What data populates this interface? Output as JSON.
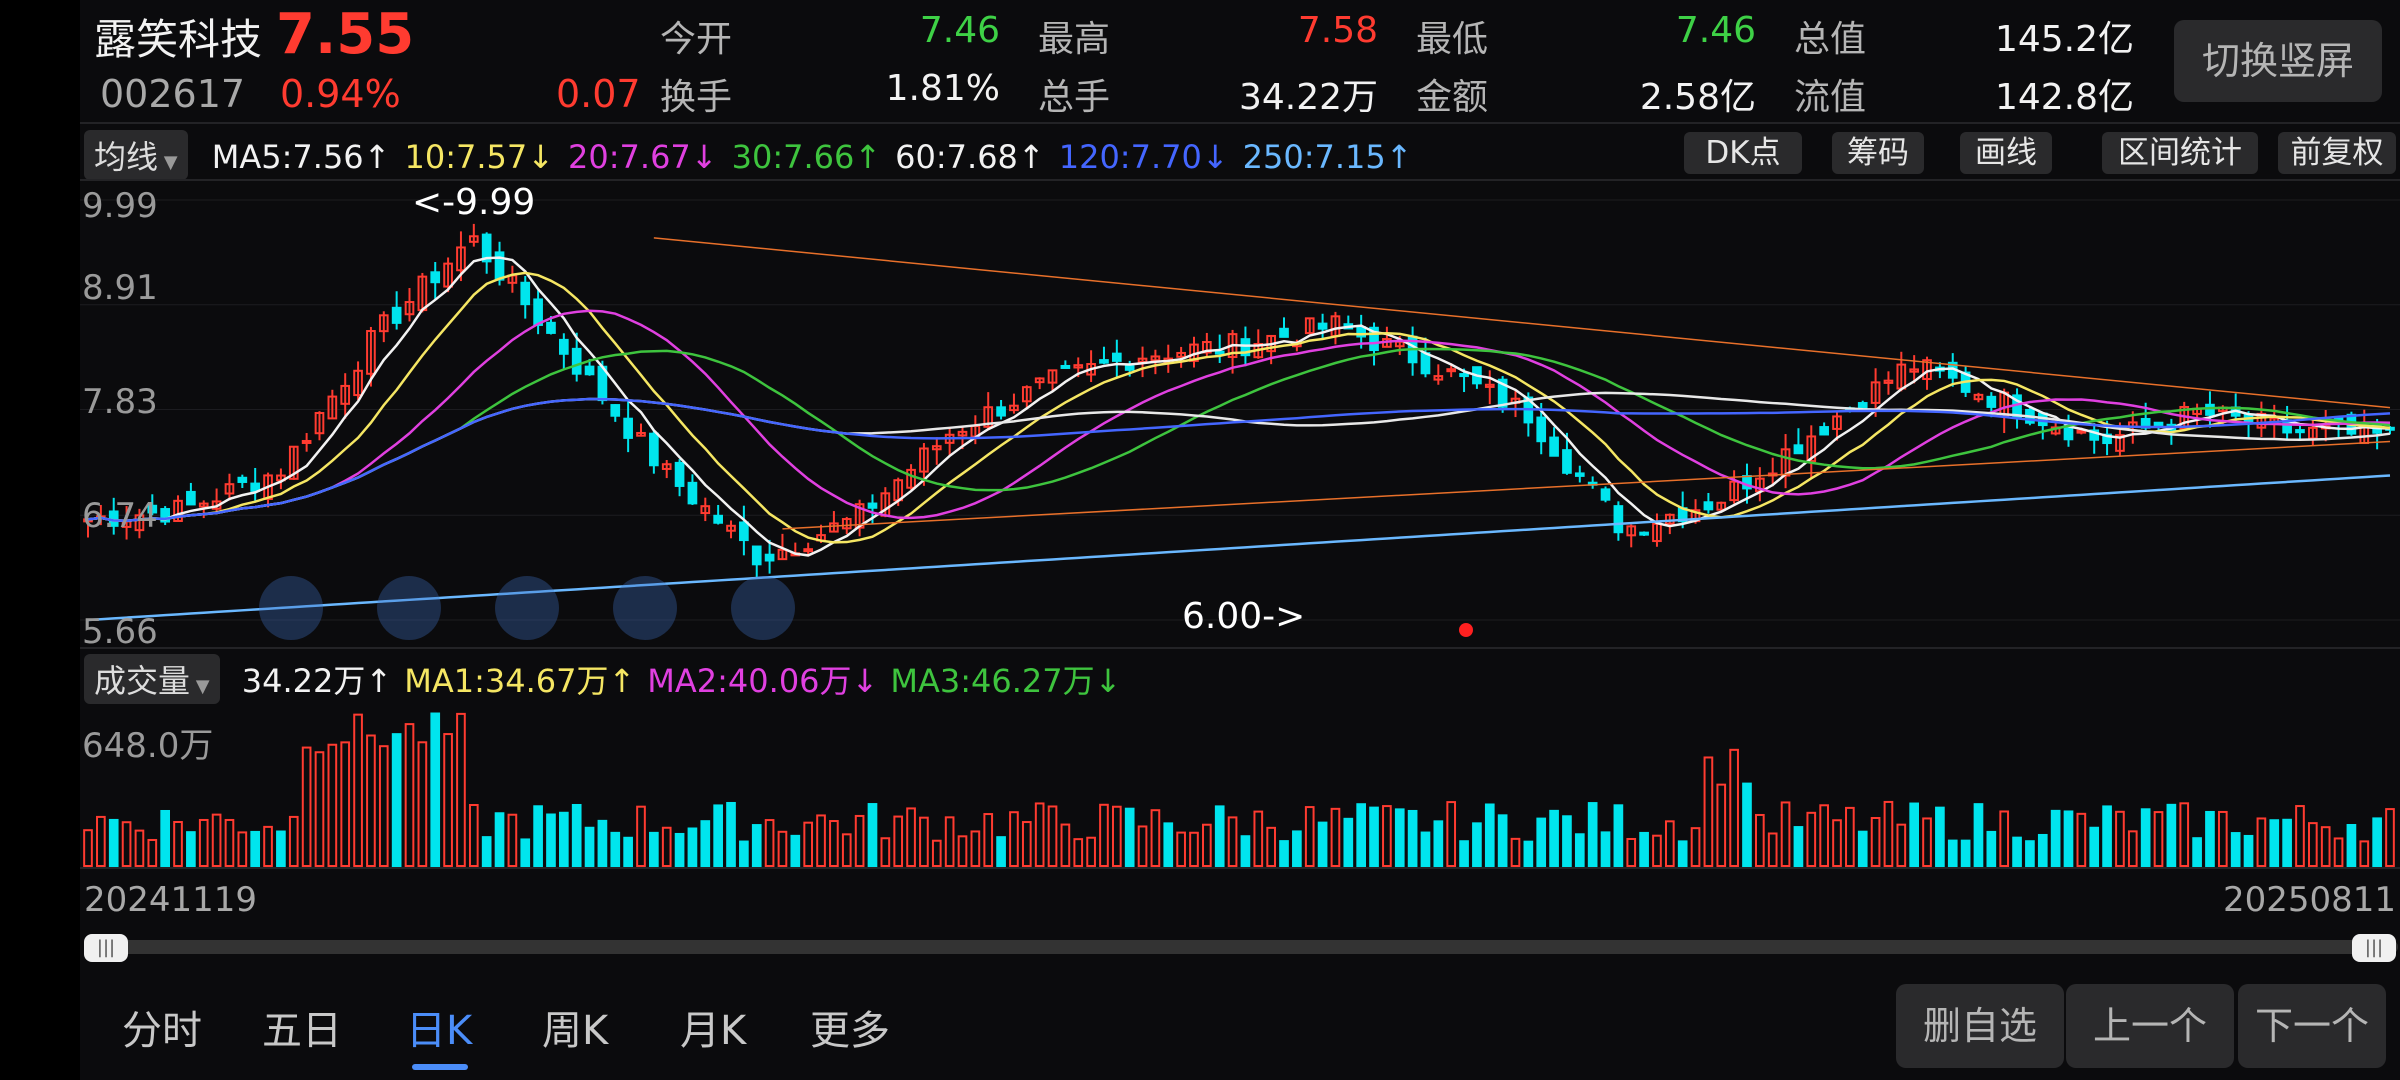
{
  "stock": {
    "name": "露笑科技",
    "price": "7.55",
    "code": "002617",
    "change_pct": "0.94%",
    "change": "0.07"
  },
  "stats": [
    {
      "label": "今开",
      "value": "7.46",
      "color": "green"
    },
    {
      "label": "最高",
      "value": "7.58",
      "color": "red"
    },
    {
      "label": "最低",
      "value": "7.46",
      "color": "green"
    },
    {
      "label": "总值",
      "value": "145.2亿",
      "color": "white"
    },
    {
      "label": "换手",
      "value": "1.81%",
      "color": "white"
    },
    {
      "label": "总手",
      "value": "34.22万",
      "color": "white"
    },
    {
      "label": "金额",
      "value": "2.58亿",
      "color": "white"
    },
    {
      "label": "流值",
      "value": "142.8亿",
      "color": "white"
    }
  ],
  "header_button": "切换竖屏",
  "ma_bar": {
    "selector": "均线",
    "items": [
      {
        "text": "MA5:7.56↑",
        "color": "#f2f2f2"
      },
      {
        "text": "10:7.57↓",
        "color": "#f5e663"
      },
      {
        "text": "20:7.67↓",
        "color": "#e040e0"
      },
      {
        "text": "30:7.66↑",
        "color": "#3ec43e"
      },
      {
        "text": "60:7.68↑",
        "color": "#f2f2f2"
      },
      {
        "text": "120:7.70↓",
        "color": "#4466ff"
      },
      {
        "text": "250:7.15↑",
        "color": "#6ab8ff"
      }
    ]
  },
  "tools": [
    "DK点",
    "筹码",
    "画线",
    "区间统计",
    "前复权"
  ],
  "price_axis": [
    "9.99",
    "8.91",
    "7.83",
    "6.74",
    "5.66"
  ],
  "annotations": {
    "high": "<-9.99",
    "low": "6.00->"
  },
  "volume_bar": {
    "selector": "成交量",
    "items": [
      {
        "text": "34.22万↑",
        "color": "#f2f2f2"
      },
      {
        "text": "MA1:34.67万↑",
        "color": "#f5e663"
      },
      {
        "text": "MA2:40.06万↓",
        "color": "#e040e0"
      },
      {
        "text": "MA3:46.27万↓",
        "color": "#3ec43e"
      }
    ],
    "axis_max": "648.0万"
  },
  "dates": {
    "start": "20241119",
    "end": "20250811"
  },
  "tabs": [
    {
      "label": "分时",
      "active": false
    },
    {
      "label": "五日",
      "active": false
    },
    {
      "label": "日K",
      "active": true
    },
    {
      "label": "周K",
      "active": false
    },
    {
      "label": "月K",
      "active": false
    },
    {
      "label": "更多",
      "active": false
    }
  ],
  "bottom_buttons": [
    "删自选",
    "上一个",
    "下一个"
  ],
  "colors": {
    "up": "#ff3b30",
    "down": "#00e5ee",
    "accent": "#4b8df8",
    "seq": "#e8702a"
  },
  "chart_data": {
    "type": "candlestick",
    "date_range": [
      "20241119",
      "20250811"
    ],
    "ylim": [
      5.66,
      9.99
    ],
    "y_ticks": [
      9.99,
      8.91,
      7.83,
      6.74,
      5.66
    ],
    "high": 9.99,
    "low": 6.0,
    "close_key_points": [
      6.7,
      6.8,
      7.2,
      8.6,
      9.6,
      8.4,
      7.2,
      6.3,
      6.7,
      7.6,
      8.1,
      8.4,
      8.5,
      8.7,
      8.3,
      7.8,
      6.6,
      6.9,
      7.6,
      8.3,
      7.9,
      7.5,
      7.8,
      7.6,
      7.55
    ],
    "volume_max": "648.0万"
  }
}
